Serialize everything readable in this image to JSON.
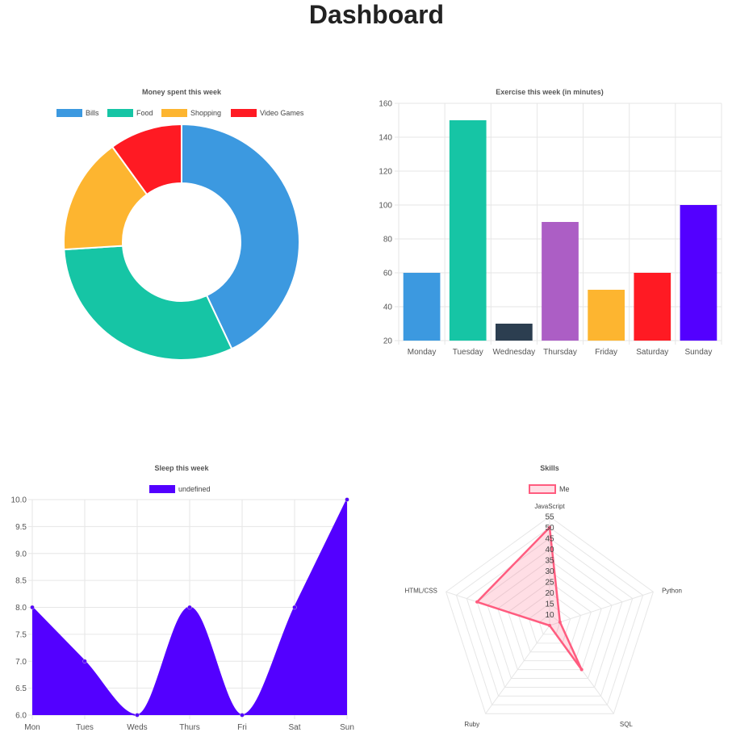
{
  "page": {
    "title": "Dashboard"
  },
  "chart_data": [
    {
      "type": "pie",
      "title": "Money spent this week",
      "legend_position": "top",
      "categories": [
        "Bills",
        "Food",
        "Shopping",
        "Video Games"
      ],
      "values": [
        43,
        31,
        16,
        10
      ],
      "colors": [
        "#3c99e0",
        "#16c5a5",
        "#fdb530",
        "#ff1a23"
      ],
      "doughnut": true
    },
    {
      "type": "bar",
      "title": "Exercise this week (in minutes)",
      "categories": [
        "Monday",
        "Tuesday",
        "Wednesday",
        "Thursday",
        "Friday",
        "Saturday",
        "Sunday"
      ],
      "values": [
        60,
        150,
        30,
        90,
        50,
        60,
        100
      ],
      "colors": [
        "#3c99e0",
        "#16c5a5",
        "#2c3e50",
        "#ac5ec5",
        "#fdb530",
        "#ff1a23",
        "#5300ff"
      ],
      "ylim": [
        20,
        160
      ],
      "yticks": [
        "20",
        "40",
        "60",
        "80",
        "100",
        "120",
        "140",
        "160"
      ],
      "grid": true
    },
    {
      "type": "area",
      "title": "Sleep this week",
      "legend_position": "top",
      "series": [
        {
          "name": "undefined",
          "values": [
            8,
            7,
            6,
            8,
            6,
            8,
            10
          ],
          "color": "#5300ff"
        }
      ],
      "categories": [
        "Mon",
        "Tues",
        "Weds",
        "Thurs",
        "Fri",
        "Sat",
        "Sun"
      ],
      "ylim": [
        6,
        10
      ],
      "yticks": [
        "6.0",
        "6.5",
        "7.0",
        "7.5",
        "8.0",
        "8.5",
        "9.0",
        "9.5",
        "10.0"
      ],
      "grid": true
    },
    {
      "type": "radar",
      "title": "Skills",
      "legend_position": "top",
      "categories": [
        "JavaScript",
        "Python",
        "SQL",
        "Ruby",
        "HTML/CSS"
      ],
      "series": [
        {
          "name": "Me",
          "values": [
            50,
            10,
            30,
            5,
            40
          ],
          "color": "#ff5c7f"
        }
      ],
      "r_range": [
        5,
        55
      ],
      "rticks": [
        "10",
        "15",
        "20",
        "25",
        "30",
        "35",
        "40",
        "45",
        "50",
        "55"
      ]
    }
  ]
}
